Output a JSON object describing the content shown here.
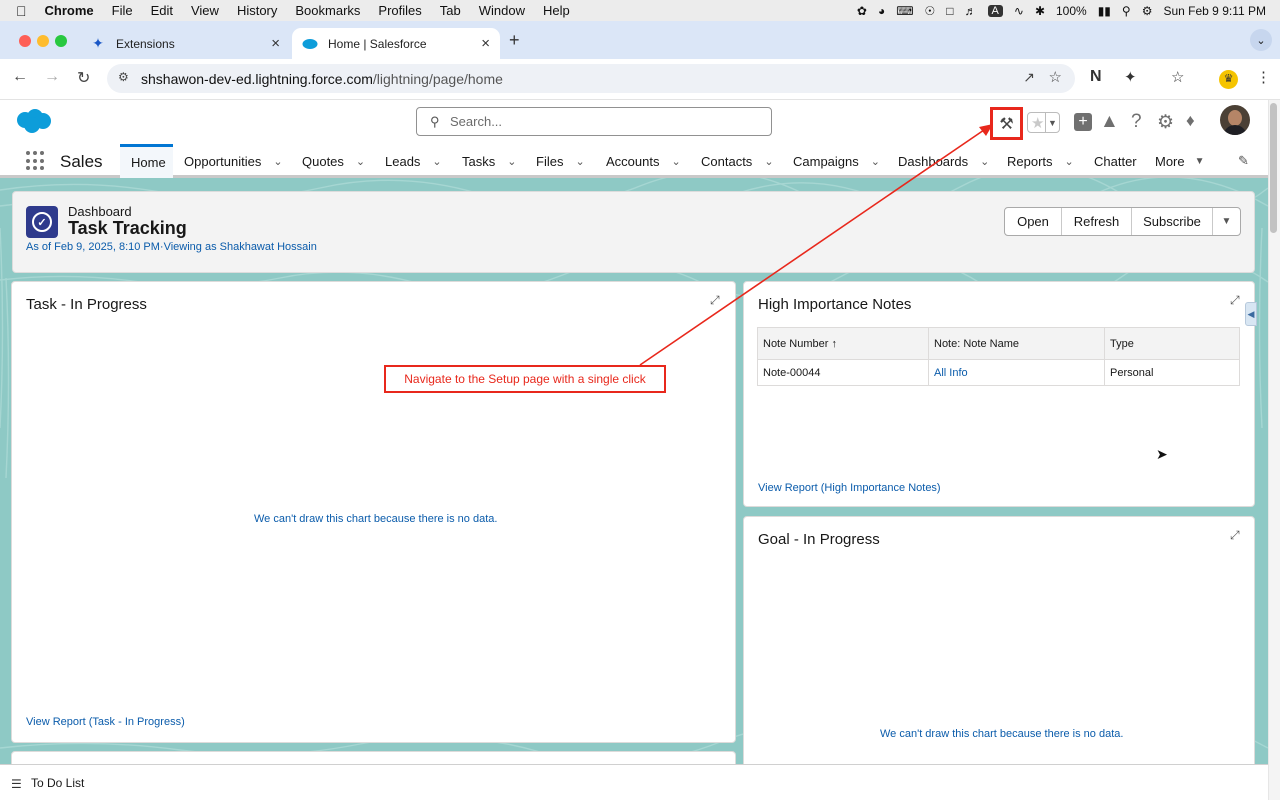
{
  "macos_menu": {
    "app": "Chrome",
    "items": [
      "File",
      "Edit",
      "View",
      "History",
      "Bookmarks",
      "Profiles",
      "Tab",
      "Window",
      "Help"
    ],
    "battery": "100%",
    "clock": "Sun Feb 9  9:11 PM",
    "input_source": "A"
  },
  "browser": {
    "tabs": [
      {
        "title": "Extensions",
        "icon": "puzzle-icon"
      },
      {
        "title": "Home | Salesforce",
        "icon": "salesforce-cloud-icon",
        "active": true
      }
    ],
    "url_host": "shshawon-dev-ed.lightning.force.com",
    "url_path": "/lightning/page/home"
  },
  "salesforce": {
    "search_placeholder": "Search...",
    "app_name": "Sales",
    "nav": [
      {
        "label": "Home",
        "active": true,
        "dropdown": false
      },
      {
        "label": "Opportunities",
        "dropdown": true
      },
      {
        "label": "Quotes",
        "dropdown": true
      },
      {
        "label": "Leads",
        "dropdown": true
      },
      {
        "label": "Tasks",
        "dropdown": true
      },
      {
        "label": "Files",
        "dropdown": true
      },
      {
        "label": "Accounts",
        "dropdown": true
      },
      {
        "label": "Contacts",
        "dropdown": true
      },
      {
        "label": "Campaigns",
        "dropdown": true
      },
      {
        "label": "Dashboards",
        "dropdown": true
      },
      {
        "label": "Reports",
        "dropdown": true
      },
      {
        "label": "Chatter",
        "dropdown": false
      },
      {
        "label": "More",
        "dropdown": true
      }
    ],
    "dashboard": {
      "type_label": "Dashboard",
      "title": "Task Tracking",
      "as_of": "As of Feb 9, 2025, 8:10 PM·Viewing as Shakhawat Hossain",
      "buttons": [
        "Open",
        "Refresh",
        "Subscribe"
      ]
    },
    "cards": {
      "task_in_progress": {
        "title": "Task - In Progress",
        "no_data": "We can't draw this chart because there is no data.",
        "view_report": "View Report (Task - In Progress)"
      },
      "high_importance_notes": {
        "title": "High Importance Notes",
        "columns": [
          "Note Number ↑",
          "Note: Note Name",
          "Type"
        ],
        "rows": [
          [
            "Note-00044",
            "All Info",
            "Personal"
          ]
        ],
        "view_report": "View Report (High Importance Notes)"
      },
      "goal_in_progress": {
        "title": "Goal - In Progress",
        "no_data": "We can't draw this chart because there is no data."
      }
    },
    "footer_utility": "To Do List"
  },
  "annotation": {
    "callout": "Navigate to the Setup page with a single click",
    "color": "#e8281c"
  }
}
